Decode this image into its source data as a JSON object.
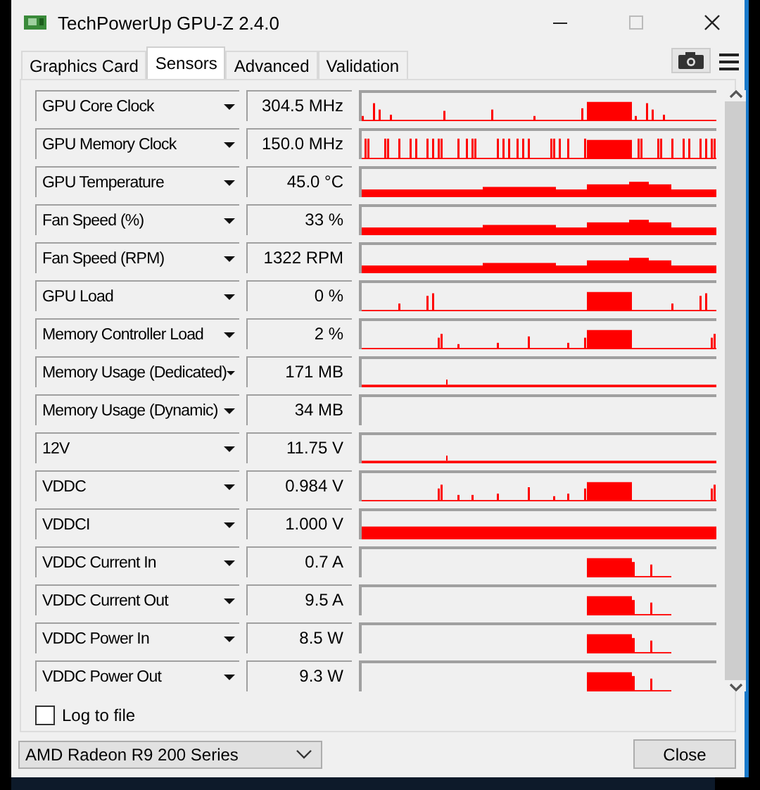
{
  "window": {
    "title": "TechPowerUp GPU-Z 2.4.0"
  },
  "tabs": [
    {
      "label": "Graphics Card",
      "selected": false
    },
    {
      "label": "Sensors",
      "selected": true
    },
    {
      "label": "Advanced",
      "selected": false
    },
    {
      "label": "Validation",
      "selected": false
    }
  ],
  "sensors": [
    {
      "name": "GPU Core Clock",
      "value": "304.5 MHz",
      "kind": "spiky"
    },
    {
      "name": "GPU Memory Clock",
      "value": "150.0 MHz",
      "kind": "dense"
    },
    {
      "name": "GPU Temperature",
      "value": "45.0 °C",
      "kind": "level"
    },
    {
      "name": "Fan Speed (%)",
      "value": "33 %",
      "kind": "level"
    },
    {
      "name": "Fan Speed (RPM)",
      "value": "1322 RPM",
      "kind": "level"
    },
    {
      "name": "GPU Load",
      "value": "0 %",
      "kind": "spiky"
    },
    {
      "name": "Memory Controller Load",
      "value": "2 %",
      "kind": "spiky"
    },
    {
      "name": "Memory Usage (Dedicated)",
      "value": "171 MB",
      "kind": "flat"
    },
    {
      "name": "Memory Usage (Dynamic)",
      "value": "34 MB",
      "kind": "empty"
    },
    {
      "name": "12V",
      "value": "11.75 V",
      "kind": "flat"
    },
    {
      "name": "VDDC",
      "value": "0.984 V",
      "kind": "spiky"
    },
    {
      "name": "VDDCI",
      "value": "1.000 V",
      "kind": "full"
    },
    {
      "name": "VDDC Current In",
      "value": "0.7 A",
      "kind": "burst"
    },
    {
      "name": "VDDC Current Out",
      "value": "9.5 A",
      "kind": "burst"
    },
    {
      "name": "VDDC Power In",
      "value": "8.5 W",
      "kind": "burst"
    },
    {
      "name": "VDDC Power Out",
      "value": "9.3 W",
      "kind": "burst"
    }
  ],
  "log_to_file": {
    "label": "Log to file",
    "checked": false
  },
  "gpu_select": {
    "value": "AMD Radeon R9 200 Series"
  },
  "buttons": [
    "Close"
  ]
}
